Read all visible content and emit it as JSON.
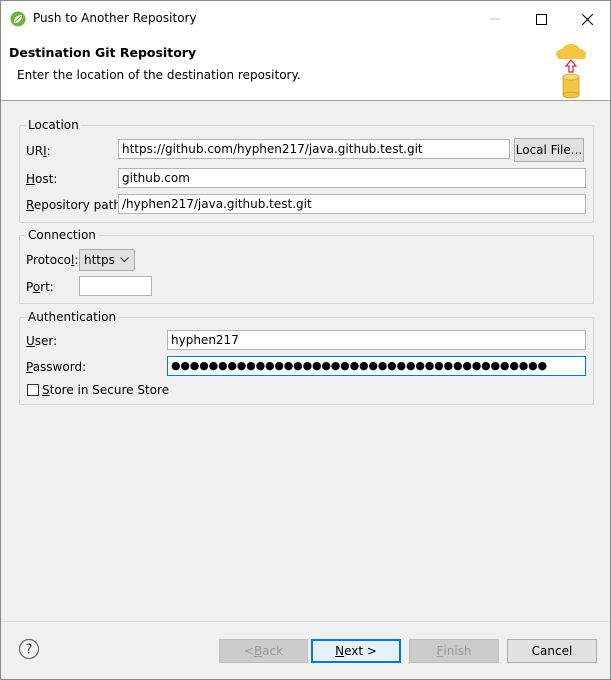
{
  "window": {
    "title": "Push to Another Repository"
  },
  "header": {
    "title": "Destination Git Repository",
    "description": "Enter the location of the destination repository."
  },
  "location": {
    "group_label": "Location",
    "uri_label_pre": "UR",
    "uri_label_key": "I",
    "uri_label_post": ":",
    "uri_value": "https://github.com/hyphen217/java.github.test.git",
    "local_file_pre": "Local File",
    "local_file_post": "...",
    "host_label_key": "H",
    "host_label_post": "ost:",
    "host_value": "github.com",
    "repo_path_label_key": "R",
    "repo_path_label_post": "epository path:",
    "repo_path_value": "/hyphen217/java.github.test.git"
  },
  "connection": {
    "group_label": "Connection",
    "protocol_label_pre": "Protoco",
    "protocol_label_key": "l",
    "protocol_label_post": ":",
    "protocol_value": "https",
    "port_label_pre": "P",
    "port_label_key": "o",
    "port_label_post": "rt:",
    "port_value": ""
  },
  "authentication": {
    "group_label": "Authentication",
    "user_label_key": "U",
    "user_label_post": "ser:",
    "user_value": "hyphen217",
    "password_label_key": "P",
    "password_label_post": "assword:",
    "password_value": "●●●●●●●●●●●●●●●●●●●●●●●●●●●●●●●●●●●●●●●●",
    "store_label_key": "S",
    "store_label_post": "tore in Secure Store",
    "store_checked": false
  },
  "footer": {
    "back_pre": "< ",
    "back_key": "B",
    "back_post": "ack",
    "next_key": "N",
    "next_post": "ext >",
    "finish_key": "F",
    "finish_post": "inish",
    "cancel_label": "Cancel"
  },
  "colors": {
    "accent": "#0078d7",
    "arrow_red": "#d9262b",
    "cloud_yellow": "#f4c542"
  }
}
